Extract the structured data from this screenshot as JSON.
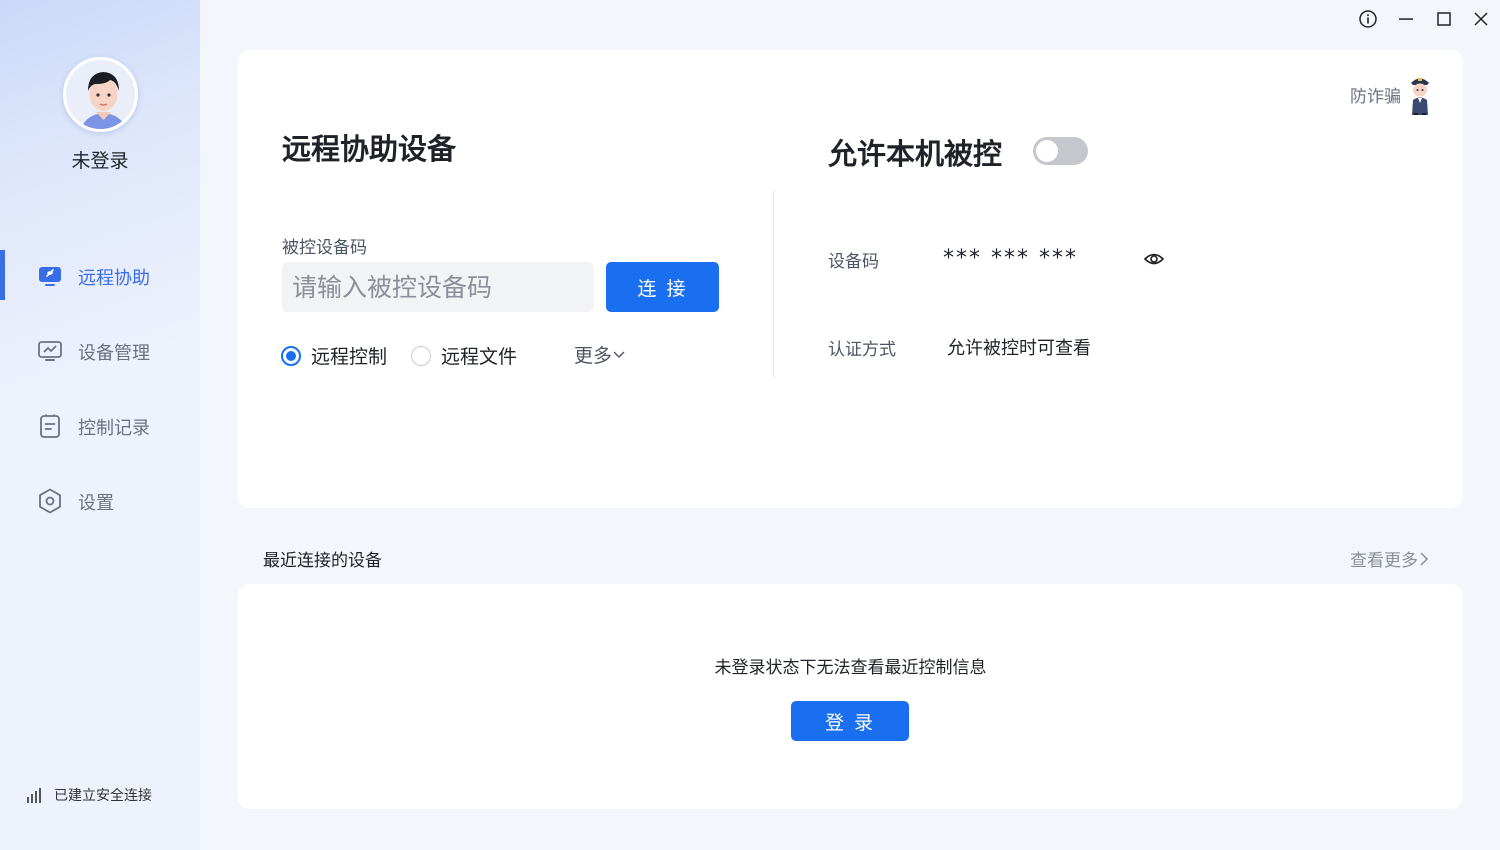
{
  "sidebar": {
    "user_name": "未登录",
    "items": [
      {
        "label": "远程协助",
        "icon": "remote-assist-icon",
        "active": true
      },
      {
        "label": "设备管理",
        "icon": "device-manage-icon",
        "active": false
      },
      {
        "label": "控制记录",
        "icon": "control-record-icon",
        "active": false
      },
      {
        "label": "设置",
        "icon": "settings-icon",
        "active": false
      }
    ],
    "connection_status": "已建立安全连接"
  },
  "window_controls": [
    "info-icon",
    "minimize-icon",
    "maximize-icon",
    "close-icon"
  ],
  "remote": {
    "title": "远程协助设备",
    "code_label": "被控设备码",
    "code_placeholder": "请输入被控设备码",
    "connect_label": "连 接",
    "mode_options": [
      {
        "label": "远程控制",
        "checked": true
      },
      {
        "label": "远程文件",
        "checked": false
      }
    ],
    "more_label": "更多"
  },
  "local": {
    "title": "允许本机被控",
    "allow_toggle": false,
    "device_code_label": "设备码",
    "device_code_value": "*** *** ***",
    "auth_label": "认证方式",
    "auth_value": "允许被控时可查看",
    "anti_fraud_label": "防诈骗"
  },
  "recent": {
    "title": "最近连接的设备",
    "view_more_label": "查看更多",
    "empty_message": "未登录状态下无法查看最近控制信息",
    "login_label": "登 录"
  },
  "colors": {
    "accent": "#1a6ff0",
    "active_nav": "#3a6ee8",
    "toggle_off": "#c5c7cc"
  }
}
